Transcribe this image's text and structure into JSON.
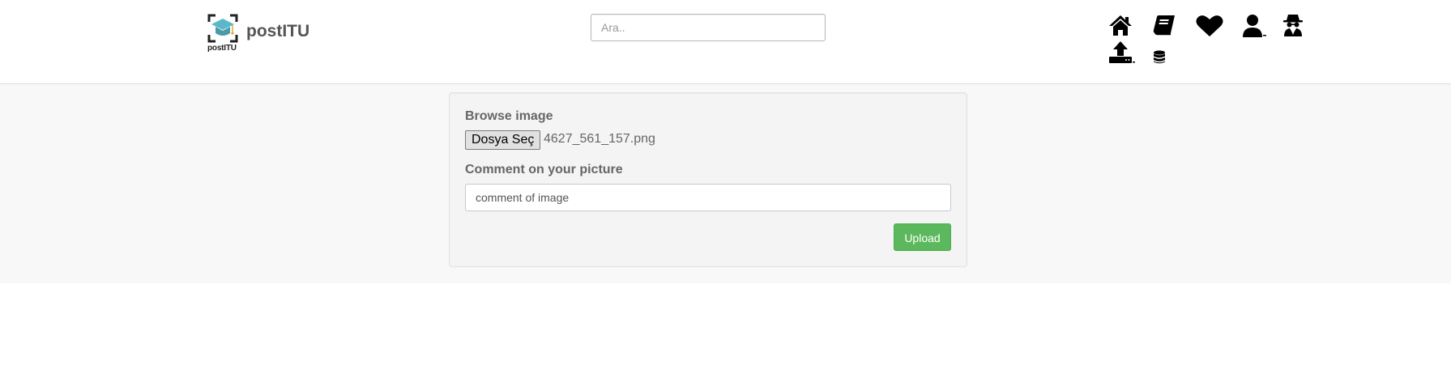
{
  "brand": {
    "logo_text": "postITU",
    "name": "postITU",
    "accent_color": "#5bb8c9"
  },
  "search": {
    "placeholder": "Ara..",
    "value": ""
  },
  "nav_icons": [
    "home-icon",
    "book-icon",
    "heart-icon",
    "user-icon",
    "spy-icon",
    "upload-icon",
    "database-icon"
  ],
  "form": {
    "browse_label": "Browse image",
    "file_button_label": "Dosya Seç",
    "file_name": "4627_561_157.png",
    "comment_label": "Comment on your picture",
    "comment_value": "comment of image",
    "upload_label": "Upload",
    "upload_color": "#5cb85c"
  }
}
